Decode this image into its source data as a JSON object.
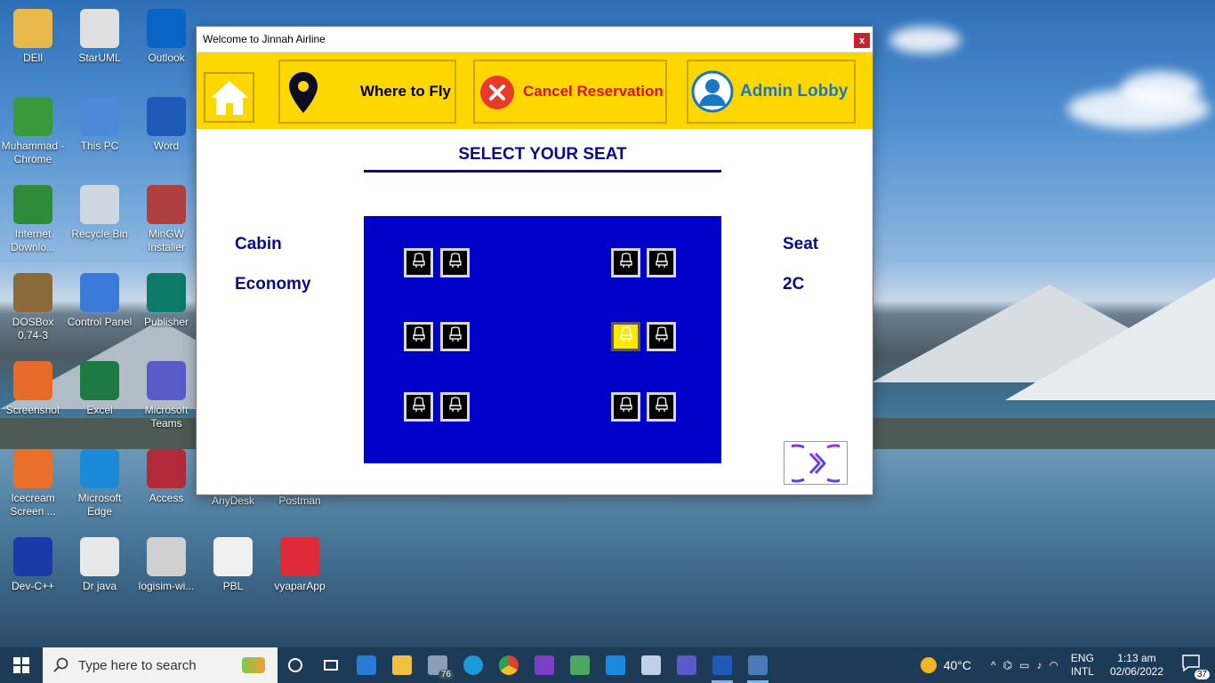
{
  "desktop": {
    "icons": [
      {
        "label": "DEll",
        "color": "#e8b84a"
      },
      {
        "label": "StarUML",
        "color": "#e0e0e0"
      },
      {
        "label": "Outlook",
        "color": "#0a64c8"
      },
      {
        "label": "Muhammad - Chrome",
        "color": "#3a9a3a"
      },
      {
        "label": "This PC",
        "color": "#4a8ad8"
      },
      {
        "label": "Word",
        "color": "#1e5bb8"
      },
      {
        "label": "Internet Downlo...",
        "color": "#2e8b3a"
      },
      {
        "label": "Recycle Bin",
        "color": "#cfd8e0"
      },
      {
        "label": "MinGW Installer",
        "color": "#b04040"
      },
      {
        "label": "DOSBox 0.74-3",
        "color": "#8a6a3a"
      },
      {
        "label": "Control Panel",
        "color": "#3a7ad8"
      },
      {
        "label": "Publisher",
        "color": "#0e7a6a"
      },
      {
        "label": "Screenshot",
        "color": "#e86a2a"
      },
      {
        "label": "Excel",
        "color": "#1e7a45"
      },
      {
        "label": "Microsoft Teams",
        "color": "#5a5ac8"
      },
      {
        "label": "Icecream Screen ...",
        "color": "#e8702a"
      },
      {
        "label": "Microsoft Edge",
        "color": "#1a8ad8"
      },
      {
        "label": "Access",
        "color": "#b02a3a"
      },
      {
        "label": "AnyDesk",
        "color": "#e04030"
      },
      {
        "label": "Postman",
        "color": "#f06a30"
      },
      {
        "label": "Dev-C++",
        "color": "#1a3aa8"
      },
      {
        "label": "Dr java",
        "color": "#e8e8e8"
      },
      {
        "label": "logisim-wi...",
        "color": "#d0d0d0"
      },
      {
        "label": "PBL",
        "color": "#f0f0f0"
      },
      {
        "label": "vyaparApp",
        "color": "#e02a3a"
      }
    ]
  },
  "window": {
    "title": "Welcome to Jinnah Airline",
    "close_label": "x",
    "nav": {
      "where_to_fly": "Where to Fly",
      "cancel_reservation": "Cancel Reservation",
      "admin_lobby": "Admin Lobby"
    },
    "heading": "SELECT YOUR SEAT",
    "cabin_label": "Cabin",
    "cabin_value": "Economy",
    "seat_label": "Seat",
    "seat_value": "2C",
    "seats": {
      "rows": 3,
      "selected": "2C"
    }
  },
  "taskbar": {
    "search_placeholder": "Type here to search",
    "weather": "40°C",
    "lang_top": "ENG",
    "lang_bottom": "INTL",
    "time": "1:13 am",
    "date": "02/06/2022",
    "notifications": "37",
    "badge_mail": "76"
  },
  "colors": {
    "nav_yellow": "#ffd700",
    "panel_blue": "#0000c8",
    "heading_navy": "#0a0a8a",
    "cancel_red": "#e01010",
    "admin_blue": "#1a78c2"
  }
}
